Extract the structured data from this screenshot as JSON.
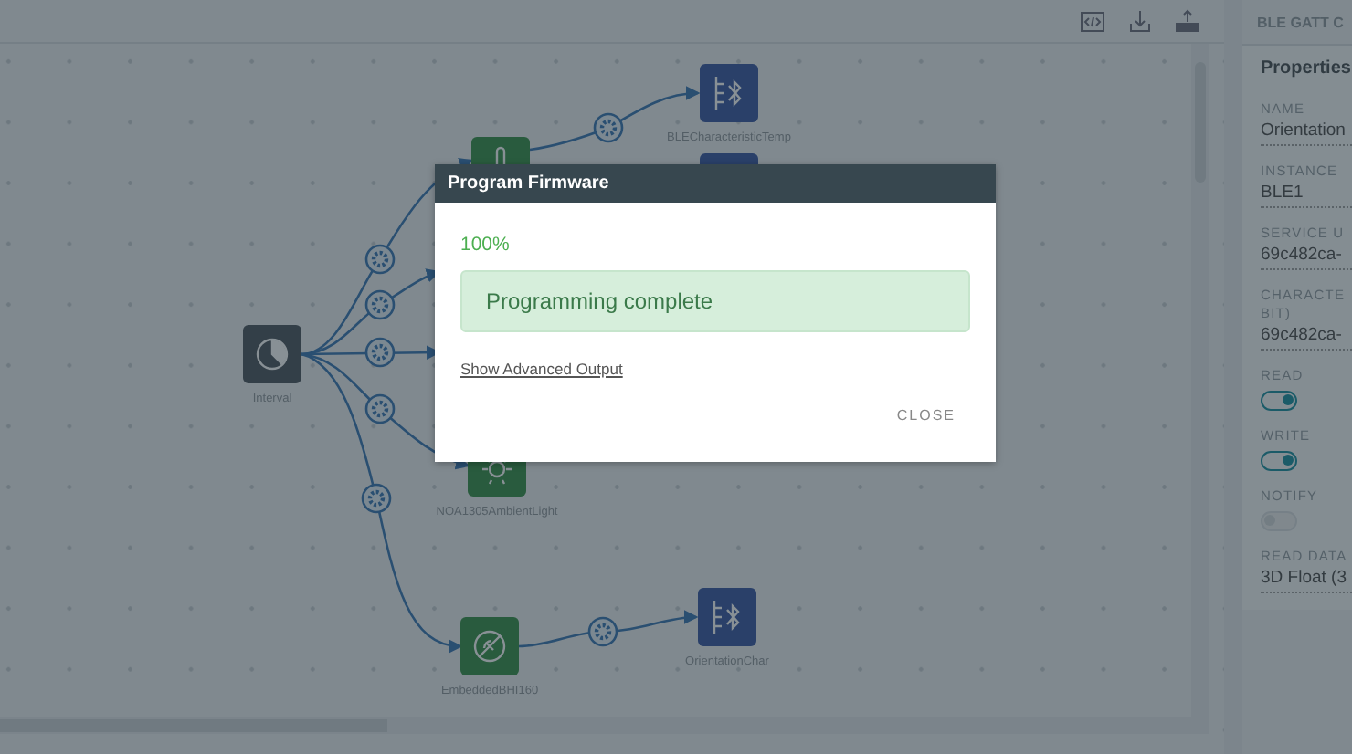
{
  "toolbar": {
    "buttons": [
      {
        "kind": "code"
      },
      {
        "kind": "download"
      },
      {
        "kind": "upload"
      }
    ]
  },
  "canvas": {
    "nodes": [
      {
        "kind": "ble",
        "label": "BLECharacteristicTemp"
      },
      {
        "kind": "thermo"
      },
      {
        "kind": "ble"
      },
      {
        "kind": "interval",
        "label": "Interval"
      },
      {
        "kind": "light",
        "label": "NOA1305AmbientLight"
      },
      {
        "kind": "bhi",
        "label": "EmbeddedBHI160"
      },
      {
        "kind": "ble",
        "label": "OrientationChar"
      }
    ]
  },
  "panel": {
    "title": "BLE GATT C",
    "section": "Properties",
    "fields": [
      {
        "kind": "text",
        "label": "NAME",
        "value": "Orientation"
      },
      {
        "kind": "text",
        "label": "INSTANCE",
        "value": "BLE1"
      },
      {
        "kind": "text",
        "label": "SERVICE U",
        "value": "69c482ca-"
      },
      {
        "kind": "text",
        "label": "CHARACTE BIT)",
        "value": "69c482ca-"
      },
      {
        "kind": "toggle",
        "label": "READ",
        "on": true
      },
      {
        "kind": "toggle",
        "label": "WRITE",
        "on": true
      },
      {
        "kind": "toggle",
        "label": "NOTIFY",
        "on": false
      },
      {
        "kind": "text",
        "label": "READ DATA",
        "value": "3D Float (3"
      }
    ]
  },
  "dialog": {
    "title": "Program Firmware",
    "progress": "100%",
    "status": "Programming complete",
    "link": "Show Advanced Output",
    "button": "CLOSE"
  }
}
